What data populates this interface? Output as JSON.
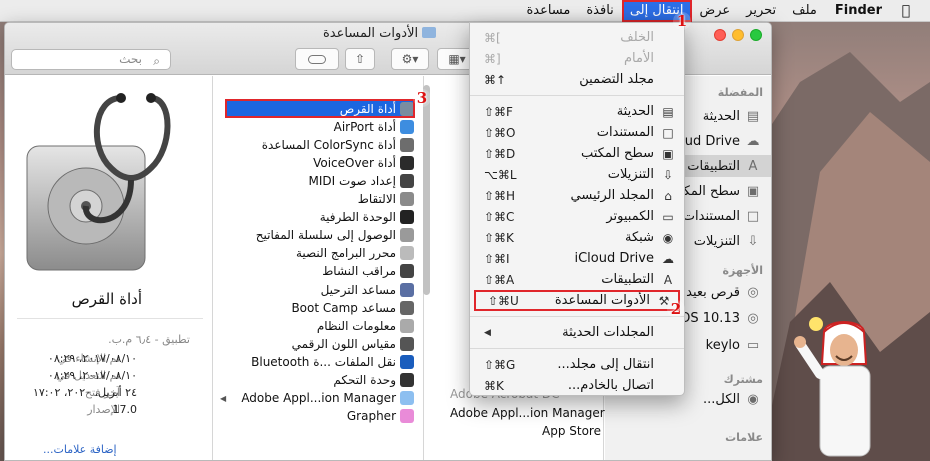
{
  "menubar": {
    "app_name": "Finder",
    "items": [
      "ملف",
      "تحرير",
      "عرض",
      "انتقال إلى",
      "نافذة",
      "مساعدة"
    ],
    "active_index": 3
  },
  "badges": {
    "one": "1",
    "two": "2",
    "three": "3"
  },
  "window": {
    "title": "الأدوات المساعدة",
    "search_placeholder": "بحث"
  },
  "preview": {
    "name": "أداة القرص",
    "meta": [
      {
        "label": "تطبيق - ٦٫٤ م.ب.",
        "value": ""
      },
      {
        "label": "تم الإنشاء في",
        "value": "٢٠١٧/٠٨/١٠، ٠٨:٢٩"
      },
      {
        "label": "تم التعديل في",
        "value": "٢٠١٧/٠٨/١٠، ٠٨:٢٩"
      },
      {
        "label": "آخر فتح",
        "value": "٢٤ أبريل، ٢٠٢٠، ١٧:٠٢"
      },
      {
        "label": "الإصدار",
        "value": "17.0"
      }
    ],
    "add_tags": "إضافة علامات..."
  },
  "utilities": [
    {
      "label": "أداة القرص",
      "selected": true
    },
    {
      "label": "أداة AirPort"
    },
    {
      "label": "أداة ColorSync المساعدة"
    },
    {
      "label": "أداة VoiceOver"
    },
    {
      "label": "إعداد صوت MIDI"
    },
    {
      "label": "الالتقاط"
    },
    {
      "label": "الوحدة الطرفية"
    },
    {
      "label": "الوصول إلى سلسلة المفاتيح"
    },
    {
      "label": "محرر البرامج النصية"
    },
    {
      "label": "مراقب النشاط"
    },
    {
      "label": "مساعد الترحيل"
    },
    {
      "label": "مساعد Boot Camp"
    },
    {
      "label": "معلومات النظام"
    },
    {
      "label": "مقياس اللون الرقمي"
    },
    {
      "label": "نقل الملفات ...ة Bluetooth"
    },
    {
      "label": "وحدة التحكم"
    },
    {
      "label": "Adobe Appl...ion Manager",
      "folder": true
    },
    {
      "label": "Grapher"
    }
  ],
  "column3": [
    "Adobe Acrobat DC",
    "Adobe Appl...ion Manager",
    "App Store"
  ],
  "sidebar": {
    "favorites_header": "المفضلة",
    "favorites": [
      "الحديثة",
      "iCloud Drive",
      "التطبيقات",
      "سطح المكتب",
      "المستندات",
      "التنزيلات"
    ],
    "devices_header": "الأجهزة",
    "devices": [
      "قرص بعيد",
      "macOS 10.13",
      "keylo"
    ],
    "shared_header": "مشترك",
    "shared": [
      "الكل..."
    ],
    "tags_header": "علامات"
  },
  "go_menu": {
    "items": [
      {
        "label": "الخلف",
        "shortcut": "⌘[",
        "icon": "",
        "disabled": true
      },
      {
        "label": "الأمام",
        "shortcut": "⌘]",
        "icon": "",
        "disabled": true
      },
      {
        "label": "مجلد التضمين",
        "shortcut": "⌘↑",
        "icon": ""
      },
      {
        "sep": true
      },
      {
        "label": "الحديثة",
        "shortcut": "⇧⌘F",
        "icon": "recents-icon"
      },
      {
        "label": "المستندات",
        "shortcut": "⇧⌘O",
        "icon": "documents-icon"
      },
      {
        "label": "سطح المكتب",
        "shortcut": "⇧⌘D",
        "icon": "desktop-icon"
      },
      {
        "label": "التنزيلات",
        "shortcut": "⌥⌘L",
        "icon": "downloads-icon"
      },
      {
        "label": "المجلد الرئيسي",
        "shortcut": "⇧⌘H",
        "icon": "home-icon"
      },
      {
        "label": "الكمبيوتر",
        "shortcut": "⇧⌘C",
        "icon": "computer-icon"
      },
      {
        "label": "شبكة",
        "shortcut": "⇧⌘K",
        "icon": "network-icon"
      },
      {
        "label": "iCloud Drive",
        "shortcut": "⇧⌘I",
        "icon": "cloud-icon"
      },
      {
        "label": "التطبيقات",
        "shortcut": "⇧⌘A",
        "icon": "applications-icon"
      },
      {
        "label": "الأدوات المساعدة",
        "shortcut": "⇧⌘U",
        "icon": "utilities-icon",
        "highlighted": true
      },
      {
        "sep": true
      },
      {
        "label": "المجلدات الحديثة",
        "shortcut": "",
        "icon": "",
        "submenu": true
      },
      {
        "sep": true
      },
      {
        "label": "انتقال إلى مجلد...",
        "shortcut": "⇧⌘G",
        "icon": ""
      },
      {
        "label": "اتصال بالخادم...",
        "shortcut": "⌘K",
        "icon": ""
      }
    ]
  },
  "colors": {
    "selection": "#1c66e0",
    "annotation_red": "#e0262b",
    "menu_active": "#2d6ee6"
  }
}
